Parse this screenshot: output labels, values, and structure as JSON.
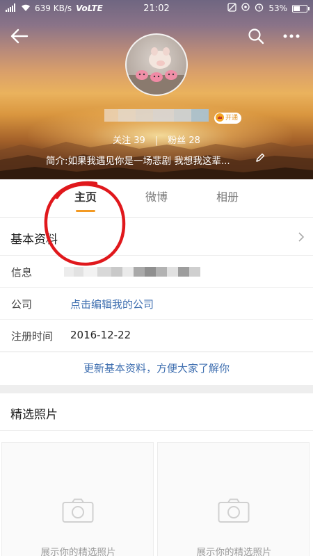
{
  "status_bar": {
    "network_speed": "639 KB/s",
    "network_type": "VoLTE",
    "time": "21:02",
    "battery": "53%",
    "battery_level": 0.53
  },
  "profile": {
    "vip_badge": "开通",
    "following_label": "关注",
    "following_count": "39",
    "separator": "|",
    "followers_label": "粉丝",
    "followers_count": "28",
    "bio": "简介:如果我遇见你是一场悲剧 我想我这辈..."
  },
  "tabs": [
    {
      "label": "主页",
      "active": true
    },
    {
      "label": "微博",
      "active": false
    },
    {
      "label": "相册",
      "active": false
    }
  ],
  "basic_info": {
    "title": "基本资料",
    "rows": [
      {
        "label": "信息",
        "value": ""
      },
      {
        "label": "公司",
        "value": "点击编辑我的公司"
      },
      {
        "label": "注册时间",
        "value": "2016-12-22"
      }
    ],
    "update_link": "更新基本资料，方便大家了解你"
  },
  "photos": {
    "title": "精选照片",
    "placeholders": [
      {
        "label": "展示你的精选照片"
      },
      {
        "label": "展示你的精选照片"
      }
    ]
  },
  "colors": {
    "accent_orange": "#f39a24",
    "link_blue": "#3f6fb0",
    "annotation_red": "#e0181c"
  },
  "icons": [
    "back-arrow-icon",
    "search-icon",
    "more-icon",
    "edit-pencil-icon",
    "chevron-right-icon",
    "camera-icon",
    "vip-crown-icon"
  ]
}
